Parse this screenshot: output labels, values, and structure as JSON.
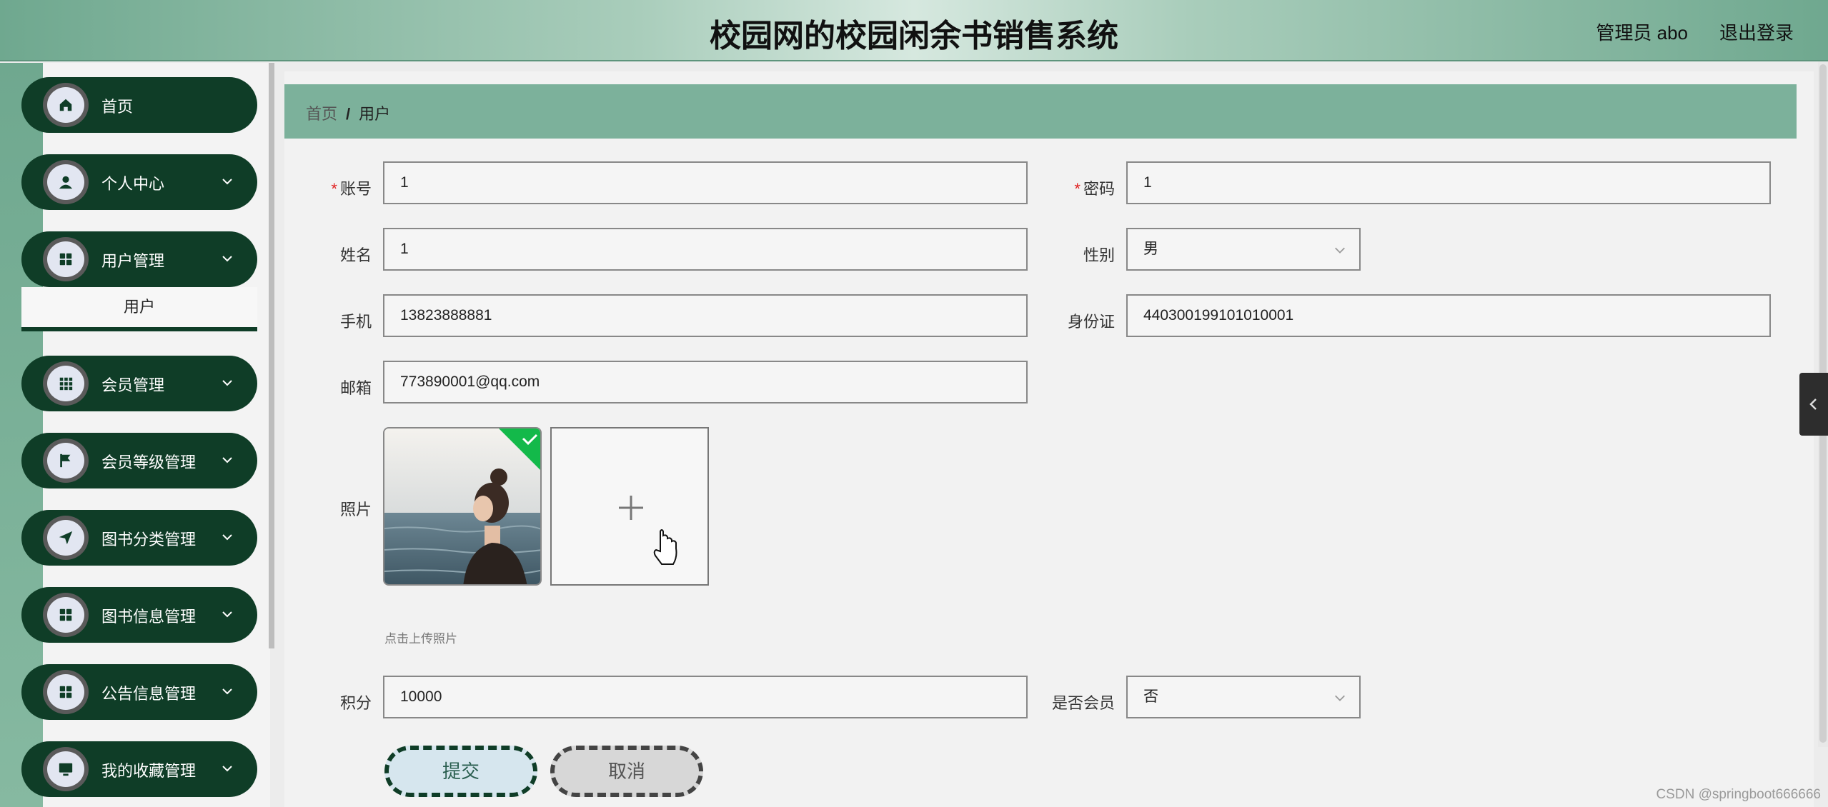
{
  "header": {
    "title": "校园网的校园闲余书销售系统",
    "user": "管理员 abo",
    "logout": "退出登录"
  },
  "sidebar": {
    "items": [
      {
        "label": "首页",
        "icon": "home-icon"
      },
      {
        "label": "个人中心",
        "icon": "person-icon"
      },
      {
        "label": "用户管理",
        "icon": "grid-icon"
      },
      {
        "label": "会员管理",
        "icon": "apps-icon"
      },
      {
        "label": "会员等级管理",
        "icon": "flag-icon"
      },
      {
        "label": "图书分类管理",
        "icon": "send-icon"
      },
      {
        "label": "图书信息管理",
        "icon": "grid-icon"
      },
      {
        "label": "公告信息管理",
        "icon": "grid-icon"
      },
      {
        "label": "我的收藏管理",
        "icon": "monitor-icon"
      }
    ],
    "submenu_active": "用户"
  },
  "breadcrumb": {
    "home": "首页",
    "separator": "/",
    "current": "用户"
  },
  "form": {
    "account": {
      "label": "账号",
      "value": "1"
    },
    "password": {
      "label": "密码",
      "value": "1"
    },
    "name": {
      "label": "姓名",
      "value": "1"
    },
    "gender": {
      "label": "性别",
      "value": "男"
    },
    "phone": {
      "label": "手机",
      "value": "13823888881"
    },
    "id_card": {
      "label": "身份证",
      "value": "440300199101010001"
    },
    "email": {
      "label": "邮箱",
      "value": "773890001@qq.com"
    },
    "photo": {
      "label": "照片",
      "hint": "点击上传照片"
    },
    "points": {
      "label": "积分",
      "value": "10000"
    },
    "is_member": {
      "label": "是否会员",
      "value": "否"
    },
    "required_mark": "*"
  },
  "buttons": {
    "submit": "提交",
    "cancel": "取消"
  },
  "watermark": "CSDN @springboot666666",
  "colors": {
    "sidebar_item": "#0f3d27",
    "breadcrumb_bar": "#7cb19b",
    "required": "#e02020",
    "upload_success": "#13b94a"
  }
}
